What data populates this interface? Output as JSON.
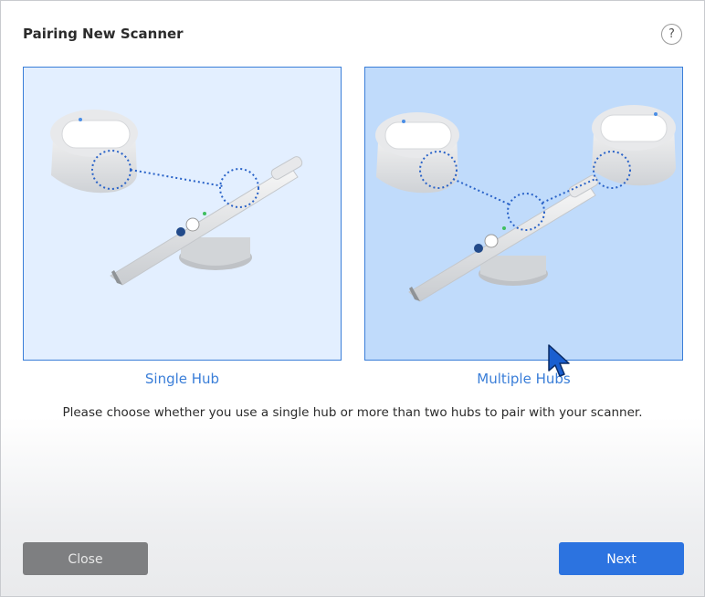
{
  "dialog": {
    "title": "Pairing New Scanner",
    "help_glyph": "?"
  },
  "options": [
    {
      "label": "Single Hub",
      "selected": false,
      "background": "#e3efff"
    },
    {
      "label": "Multiple Hubs",
      "selected": true,
      "background": "#c0dbfb"
    }
  ],
  "instruction": "Please choose whether you use a single hub or more than two hubs to pair with your scanner.",
  "buttons": {
    "close_label": "Close",
    "next_label": "Next"
  },
  "colors": {
    "accent": "#3a7ed8",
    "primary_button": "#2c73e0",
    "secondary_button": "#7e7f81"
  },
  "icons": {
    "help": "help-icon",
    "cursor": "mouse-pointer-icon"
  }
}
